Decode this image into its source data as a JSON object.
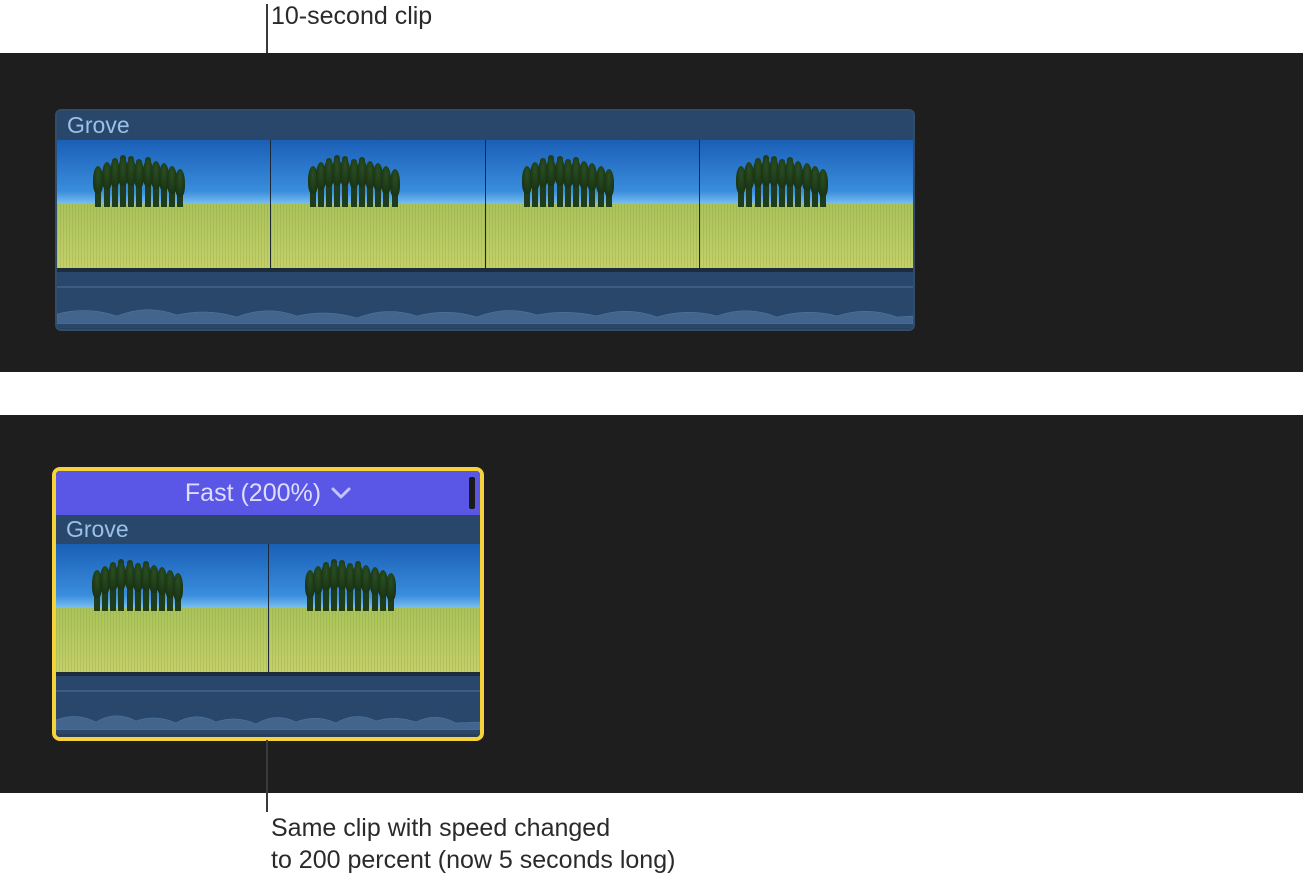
{
  "callouts": {
    "top_label": "10-second clip",
    "bottom_label_line1": "Same clip with speed changed",
    "bottom_label_line2": "to 200 percent (now 5 seconds long)"
  },
  "clips": {
    "top": {
      "name": "Grove",
      "thumbnail_count": 4
    },
    "bottom": {
      "name": "Grove",
      "thumbnail_count": 2,
      "speed_label": "Fast (200%)",
      "selected": true
    }
  }
}
